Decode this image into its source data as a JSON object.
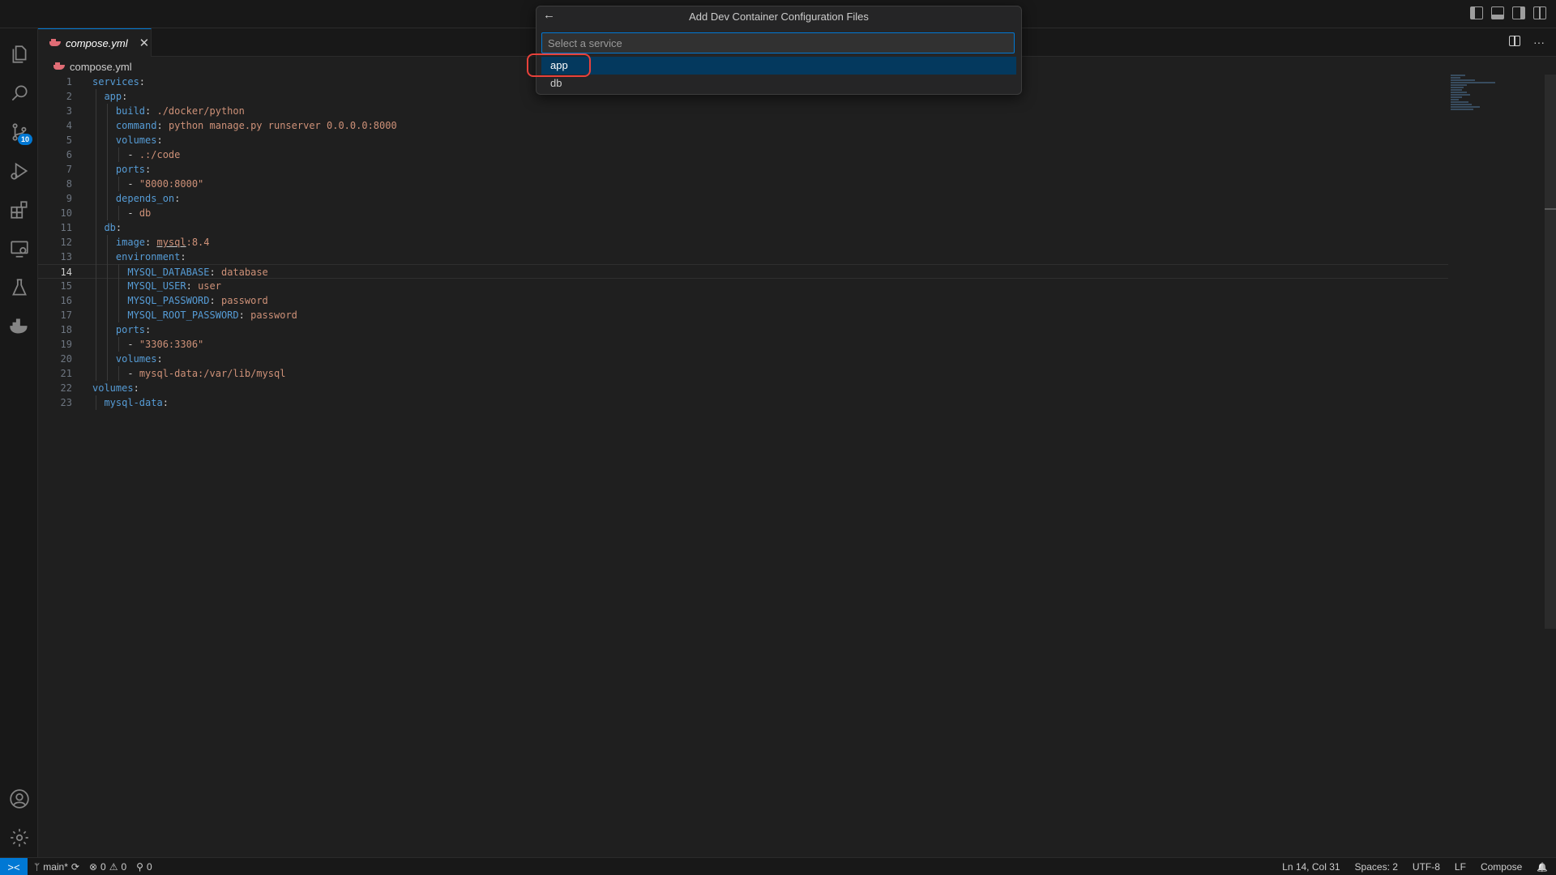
{
  "quick_pick": {
    "title": "Add Dev Container Configuration Files",
    "back_glyph": "←",
    "placeholder": "Select a service",
    "items": [
      {
        "label": "app",
        "selected": true
      },
      {
        "label": "db",
        "selected": false
      }
    ]
  },
  "tab": {
    "label": "compose.yml",
    "close_glyph": "✕"
  },
  "editor_actions": {
    "more_glyph": "···"
  },
  "breadcrumb": {
    "file": "compose.yml"
  },
  "activity_bar": {
    "icons": [
      "explorer-icon",
      "search-icon",
      "source-control-icon",
      "run-debug-icon",
      "extensions-icon",
      "remote-explorer-icon",
      "testing-icon",
      "docker-icon",
      "accounts-icon",
      "settings-gear-icon"
    ],
    "source_control_badge": "10"
  },
  "code_lines": [
    {
      "n": "1",
      "indent": "",
      "key": "services",
      "sep": ":",
      "value": ""
    },
    {
      "n": "2",
      "indent": "  ",
      "key": "app",
      "sep": ":",
      "value": ""
    },
    {
      "n": "3",
      "indent": "    ",
      "key": "build",
      "sep": ": ",
      "value": "./docker/python"
    },
    {
      "n": "4",
      "indent": "    ",
      "key": "command",
      "sep": ": ",
      "value": "python manage.py runserver 0.0.0.0:8000"
    },
    {
      "n": "5",
      "indent": "    ",
      "key": "volumes",
      "sep": ":",
      "value": ""
    },
    {
      "n": "6",
      "indent": "      ",
      "key": "",
      "sep": "- ",
      "value": ".:/code"
    },
    {
      "n": "7",
      "indent": "    ",
      "key": "ports",
      "sep": ":",
      "value": ""
    },
    {
      "n": "8",
      "indent": "      ",
      "key": "",
      "sep": "- ",
      "value": "\"8000:8000\""
    },
    {
      "n": "9",
      "indent": "    ",
      "key": "depends_on",
      "sep": ":",
      "value": ""
    },
    {
      "n": "10",
      "indent": "      ",
      "key": "",
      "sep": "- ",
      "value": "db"
    },
    {
      "n": "11",
      "indent": "  ",
      "key": "db",
      "sep": ":",
      "value": ""
    },
    {
      "n": "12",
      "indent": "    ",
      "key": "image",
      "sep": ": ",
      "value": "mysql:8.4"
    },
    {
      "n": "13",
      "indent": "    ",
      "key": "environment",
      "sep": ":",
      "value": ""
    },
    {
      "n": "14",
      "indent": "      ",
      "key": "MYSQL_DATABASE",
      "sep": ": ",
      "value": "database"
    },
    {
      "n": "15",
      "indent": "      ",
      "key": "MYSQL_USER",
      "sep": ": ",
      "value": "user"
    },
    {
      "n": "16",
      "indent": "      ",
      "key": "MYSQL_PASSWORD",
      "sep": ": ",
      "value": "password"
    },
    {
      "n": "17",
      "indent": "      ",
      "key": "MYSQL_ROOT_PASSWORD",
      "sep": ": ",
      "value": "password"
    },
    {
      "n": "18",
      "indent": "    ",
      "key": "ports",
      "sep": ":",
      "value": ""
    },
    {
      "n": "19",
      "indent": "      ",
      "key": "",
      "sep": "- ",
      "value": "\"3306:3306\""
    },
    {
      "n": "20",
      "indent": "    ",
      "key": "volumes",
      "sep": ":",
      "value": ""
    },
    {
      "n": "21",
      "indent": "      ",
      "key": "",
      "sep": "- ",
      "value": "mysql-data:/var/lib/mysql"
    },
    {
      "n": "22",
      "indent": "",
      "key": "volumes",
      "sep": ":",
      "value": ""
    },
    {
      "n": "23",
      "indent": "  ",
      "key": "mysql-data",
      "sep": ":",
      "value": ""
    }
  ],
  "current_line": "14",
  "status_bar": {
    "remote_glyph": "><",
    "branch": "main*",
    "sync_glyph": "⟳",
    "errors": "0",
    "warnings": "0",
    "ports": "0",
    "cursor": "Ln 14, Col 31",
    "spaces": "Spaces: 2",
    "encoding": "UTF-8",
    "eol": "LF",
    "language": "Compose",
    "bell_glyph": "🔔"
  },
  "colors": {
    "accent": "#0078d4",
    "keyword": "#569cd6",
    "string": "#ce9178",
    "highlight_ring": "#e8413b",
    "selected_item": "#04395e"
  }
}
